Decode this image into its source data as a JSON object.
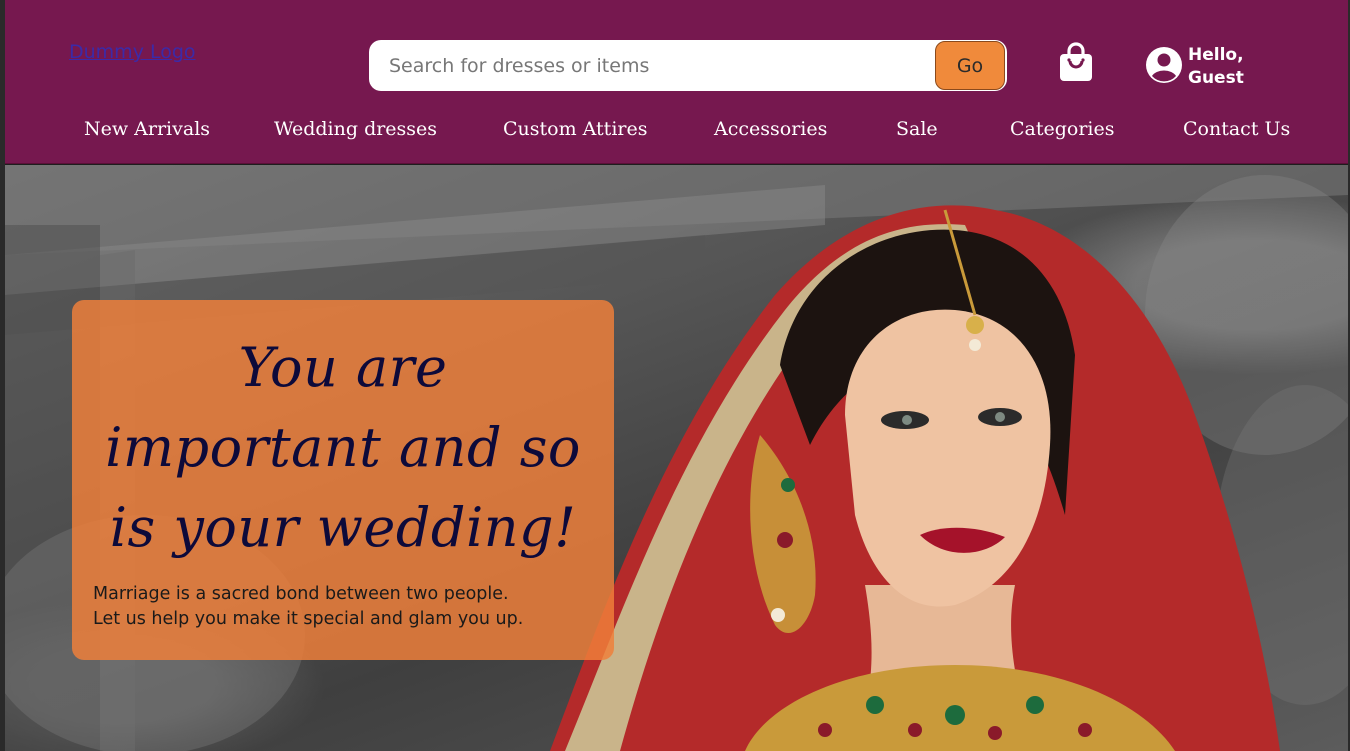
{
  "header": {
    "logo_text": "Dummy Logo",
    "search": {
      "placeholder": "Search for dresses or items",
      "value": ""
    },
    "go_label": "Go",
    "cart_icon": "shopping-bag-icon",
    "user": {
      "icon": "user-circle-icon",
      "greeting_line1": "Hello,",
      "greeting_line2": "Guest"
    },
    "nav": [
      {
        "label": "New Arrivals"
      },
      {
        "label": "Wedding dresses"
      },
      {
        "label": "Custom Attires"
      },
      {
        "label": "Accessories"
      },
      {
        "label": "Sale"
      },
      {
        "label": "Categories"
      },
      {
        "label": "Contact Us"
      }
    ]
  },
  "hero": {
    "title_line1": "You are",
    "title_line2": "important and so",
    "title_line3": "is your wedding!",
    "body_line1": "Marriage is a sacred bond between two people.",
    "body_line2": "Let us help you make it special and glam you up."
  },
  "colors": {
    "header_bg": "#76184f",
    "accent_orange": "#f08a3b",
    "title_navy": "#0d0a3a"
  }
}
